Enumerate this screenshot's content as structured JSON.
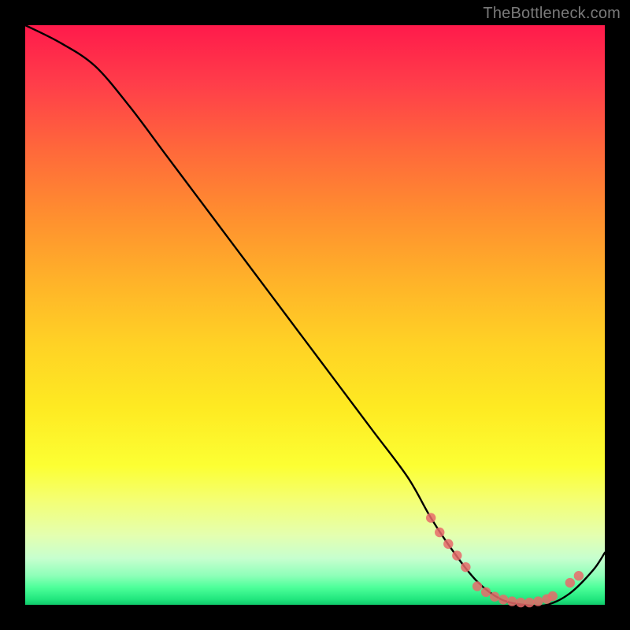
{
  "watermark": {
    "text": "TheBottleneck.com"
  },
  "chart_data": {
    "type": "line",
    "title": "",
    "xlabel": "",
    "ylabel": "",
    "xlim": [
      0,
      100
    ],
    "ylim": [
      0,
      100
    ],
    "grid": false,
    "legend": false,
    "series": [
      {
        "name": "bottleneck-curve",
        "color": "#000000",
        "x": [
          0,
          6,
          12,
          18,
          24,
          30,
          36,
          42,
          48,
          54,
          60,
          66,
          70,
          74,
          78,
          82,
          86,
          90,
          94,
          98,
          100
        ],
        "y": [
          100,
          97,
          93,
          86,
          78,
          70,
          62,
          54,
          46,
          38,
          30,
          22,
          15,
          9,
          4,
          1,
          0,
          0,
          2,
          6,
          9
        ]
      }
    ],
    "markers": [
      {
        "name": "cluster-left",
        "color": "#e86a6a",
        "x": [
          70,
          71.5,
          73,
          74.5,
          76
        ],
        "y": [
          15,
          12.5,
          10.5,
          8.5,
          6.5
        ]
      },
      {
        "name": "cluster-valley",
        "color": "#e86a6a",
        "x": [
          78,
          79.5,
          81,
          82.5,
          84,
          85.5,
          87,
          88.5,
          90,
          91
        ],
        "y": [
          3.2,
          2.2,
          1.4,
          0.9,
          0.6,
          0.4,
          0.4,
          0.6,
          1.0,
          1.5
        ]
      },
      {
        "name": "cluster-right",
        "color": "#e86a6a",
        "x": [
          94,
          95.5
        ],
        "y": [
          3.8,
          5.0
        ]
      }
    ]
  }
}
